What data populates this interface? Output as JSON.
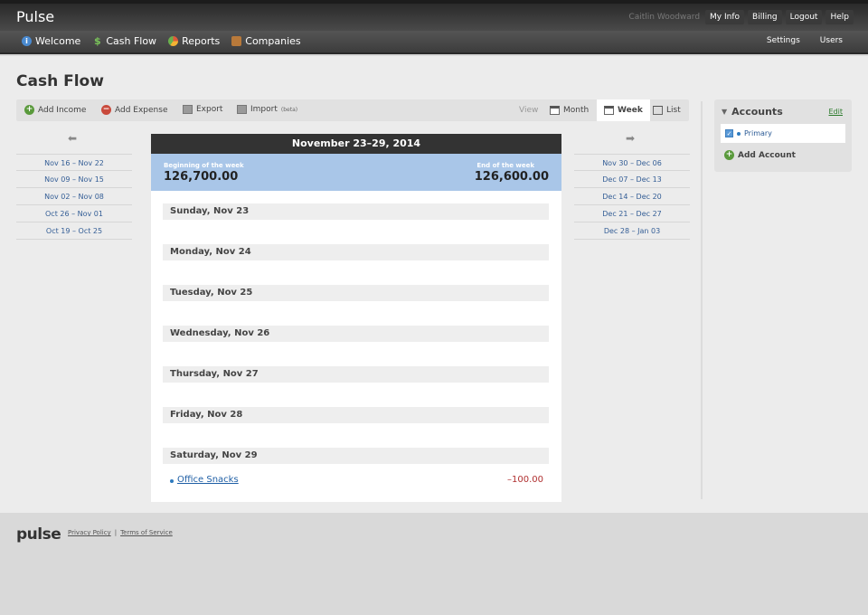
{
  "app": {
    "logo": "Pulse"
  },
  "topbar": {
    "user_name": "Caitlin Woodward",
    "links": [
      "My Info",
      "Billing",
      "Logout",
      "Help"
    ]
  },
  "nav": {
    "items": [
      {
        "label": "Welcome",
        "icon": "info-icon"
      },
      {
        "label": "Cash Flow",
        "icon": "dollar-icon"
      },
      {
        "label": "Reports",
        "icon": "pie-chart-icon"
      },
      {
        "label": "Companies",
        "icon": "briefcase-icon"
      }
    ],
    "right": [
      "Settings",
      "Users"
    ]
  },
  "page": {
    "title": "Cash Flow"
  },
  "toolbar": {
    "add_income": "Add Income",
    "add_expense": "Add Expense",
    "export": "Export",
    "import": "Import",
    "import_tag": "(beta)",
    "view_label": "View",
    "views": [
      "Month",
      "Week",
      "List"
    ],
    "active_view": "Week"
  },
  "prev_weeks": [
    "Nov 16 – Nov 22",
    "Nov 09 – Nov 15",
    "Nov 02 – Nov 08",
    "Oct 26 – Nov 01",
    "Oct 19 – Oct 25"
  ],
  "next_weeks": [
    "Nov 30 – Dec 06",
    "Dec 07 – Dec 13",
    "Dec 14 – Dec 20",
    "Dec 21 – Dec 27",
    "Dec 28 – Jan 03"
  ],
  "calendar": {
    "title": "November 23–29, 2014",
    "begin_label": "Beginning of the week",
    "begin_value": "126,700.00",
    "end_label": "End of the week",
    "end_value": "126,600.00",
    "days": [
      "Sunday, Nov 23",
      "Monday, Nov 24",
      "Tuesday, Nov 25",
      "Wednesday, Nov 26",
      "Thursday, Nov 27",
      "Friday, Nov 28",
      "Saturday, Nov 29"
    ],
    "transactions": [
      {
        "name": "Office Snacks",
        "amount": "–100.00"
      }
    ]
  },
  "accounts": {
    "title": "Accounts",
    "edit": "Edit",
    "items": [
      {
        "name": "Primary",
        "checked": true
      }
    ],
    "add": "Add Account"
  },
  "footer": {
    "logo": "pulse",
    "privacy": "Privacy Policy",
    "sep": "|",
    "terms": "Terms of Service"
  },
  "colors": {
    "balance_bar": "#a9c6e8",
    "link_blue": "#345e96",
    "negative": "#b03030",
    "income_green": "#5a9a3c",
    "expense_red": "#c94a3c"
  }
}
